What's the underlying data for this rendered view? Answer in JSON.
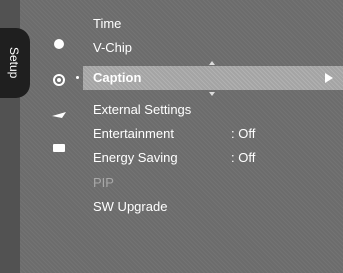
{
  "menu": {
    "tab_label": "Setup",
    "icons": [
      "picture-icon",
      "settings-gear-icon",
      "input-icon",
      "application-icon"
    ],
    "items": [
      {
        "label": "Time",
        "value": "",
        "disabled": false
      },
      {
        "label": "V-Chip",
        "value": "",
        "disabled": false
      },
      {
        "label": "Caption",
        "value": "",
        "disabled": false,
        "selected": true
      },
      {
        "label": "External Settings",
        "value": "",
        "disabled": false
      },
      {
        "label": "Entertainment",
        "value": ": Off",
        "disabled": false
      },
      {
        "label": "Energy Saving",
        "value": ": Off",
        "disabled": false
      },
      {
        "label": "PIP",
        "value": "",
        "disabled": true
      },
      {
        "label": "SW Upgrade",
        "value": "",
        "disabled": false
      }
    ]
  }
}
